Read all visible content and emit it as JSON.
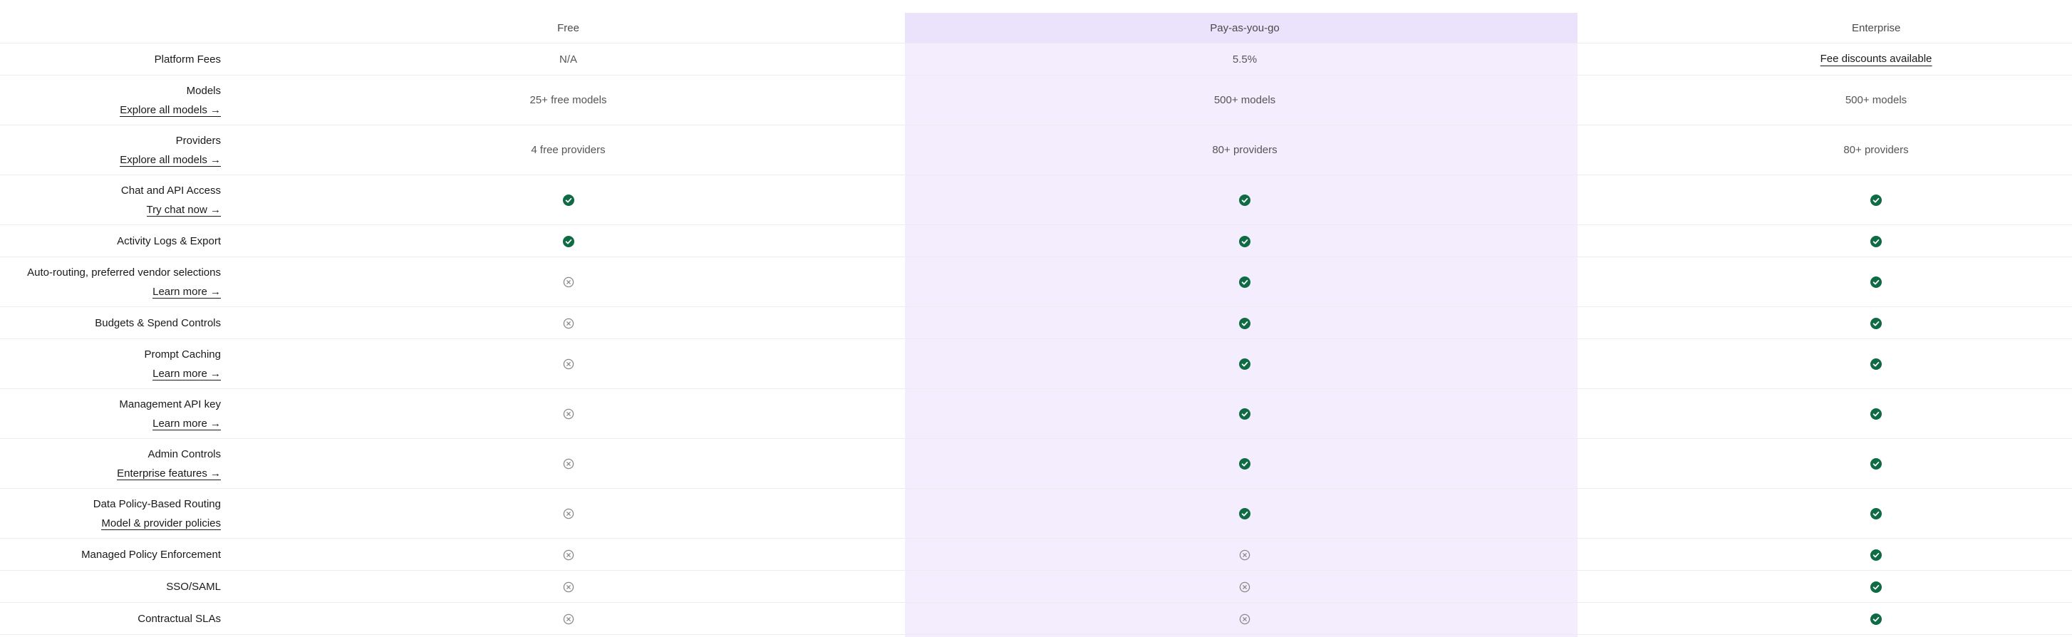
{
  "colors": {
    "highlight_column": "#f3edfd",
    "highlight_header": "#ebe2fc",
    "check": "#0f6b44",
    "x_icon": "#8a8a8a",
    "divider": "#ececec"
  },
  "plans": {
    "free": "Free",
    "payg": "Pay-as-you-go",
    "enterprise": "Enterprise"
  },
  "rows": [
    {
      "label": "Platform Fees",
      "link": "",
      "free": {
        "type": "text",
        "text": "N/A"
      },
      "payg": {
        "type": "text",
        "text": "5.5%"
      },
      "enterprise": {
        "type": "link",
        "text": "Fee discounts available"
      }
    },
    {
      "label": "Models",
      "link": "Explore all models →",
      "free": {
        "type": "text",
        "text": "25+ free models"
      },
      "payg": {
        "type": "text",
        "text": "500+ models"
      },
      "enterprise": {
        "type": "text",
        "text": "500+ models"
      }
    },
    {
      "label": "Providers",
      "link": "Explore all models →",
      "free": {
        "type": "text",
        "text": "4 free providers"
      },
      "payg": {
        "type": "text",
        "text": "80+ providers"
      },
      "enterprise": {
        "type": "text",
        "text": "80+ providers"
      }
    },
    {
      "label": "Chat and API Access",
      "link": "Try chat now →",
      "free": {
        "type": "check"
      },
      "payg": {
        "type": "check"
      },
      "enterprise": {
        "type": "check"
      }
    },
    {
      "label": "Activity Logs & Export",
      "link": "",
      "free": {
        "type": "check"
      },
      "payg": {
        "type": "check"
      },
      "enterprise": {
        "type": "check"
      }
    },
    {
      "label": "Auto-routing, preferred vendor selections",
      "link": "Learn more →",
      "free": {
        "type": "x"
      },
      "payg": {
        "type": "check"
      },
      "enterprise": {
        "type": "check"
      }
    },
    {
      "label": "Budgets & Spend Controls",
      "link": "",
      "free": {
        "type": "x"
      },
      "payg": {
        "type": "check"
      },
      "enterprise": {
        "type": "check"
      }
    },
    {
      "label": "Prompt Caching",
      "link": "Learn more →",
      "free": {
        "type": "x"
      },
      "payg": {
        "type": "check"
      },
      "enterprise": {
        "type": "check"
      }
    },
    {
      "label": "Management API key",
      "link": "Learn more →",
      "free": {
        "type": "x"
      },
      "payg": {
        "type": "check"
      },
      "enterprise": {
        "type": "check"
      }
    },
    {
      "label": "Admin Controls",
      "link": "Enterprise features →",
      "free": {
        "type": "x"
      },
      "payg": {
        "type": "check"
      },
      "enterprise": {
        "type": "check"
      }
    },
    {
      "label": "Data Policy-Based Routing",
      "link": "Model & provider policies",
      "free": {
        "type": "x"
      },
      "payg": {
        "type": "check"
      },
      "enterprise": {
        "type": "check"
      }
    },
    {
      "label": "Managed Policy Enforcement",
      "link": "",
      "free": {
        "type": "x"
      },
      "payg": {
        "type": "x"
      },
      "enterprise": {
        "type": "check"
      }
    },
    {
      "label": "SSO/SAML",
      "link": "",
      "free": {
        "type": "x"
      },
      "payg": {
        "type": "x"
      },
      "enterprise": {
        "type": "check"
      }
    },
    {
      "label": "Contractual SLAs",
      "link": "",
      "free": {
        "type": "x"
      },
      "payg": {
        "type": "x"
      },
      "enterprise": {
        "type": "check"
      }
    }
  ]
}
